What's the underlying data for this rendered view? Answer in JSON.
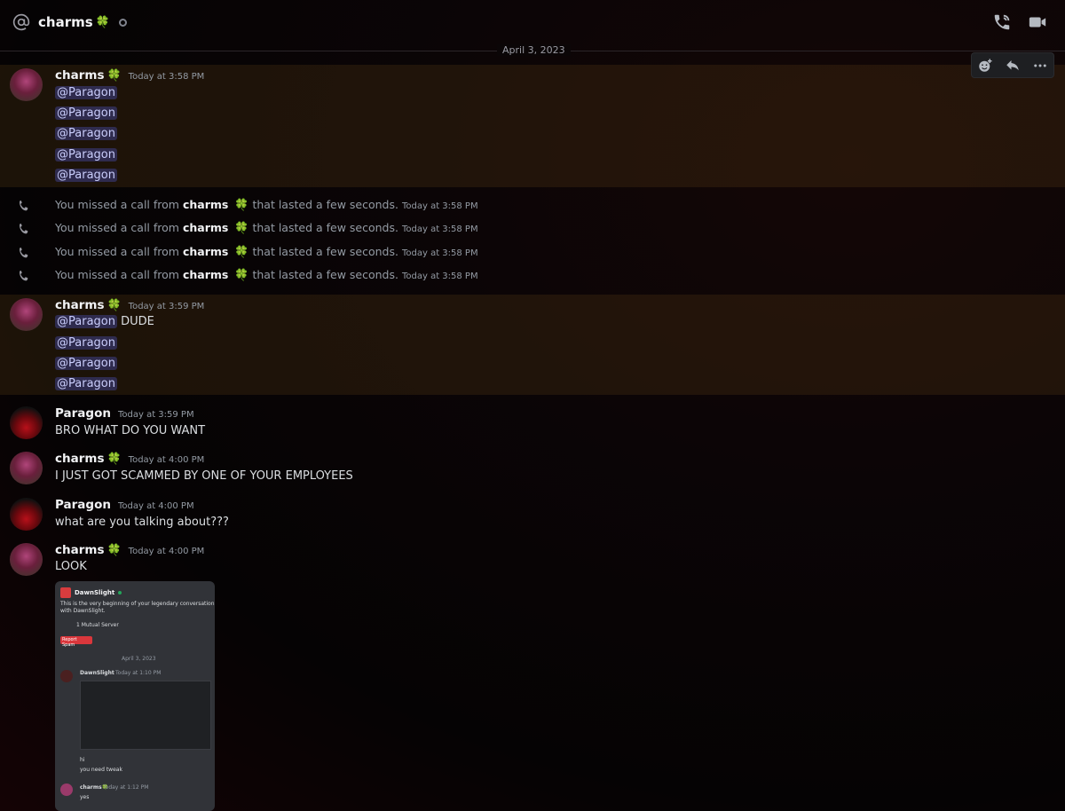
{
  "header": {
    "title": "charms",
    "title_emoji": "🍀"
  },
  "divider": {
    "date": "April 3, 2023"
  },
  "groups": [
    {
      "author": "charms",
      "emoji": "🍀",
      "timestamp": "Today at 3:58 PM",
      "lines": [
        "@Paragon",
        "@Paragon",
        "@Paragon",
        "@Paragon",
        "@Paragon"
      ]
    },
    {
      "author": "charms",
      "emoji": "🍀",
      "timestamp": "Today at 3:59 PM",
      "first_line_mention": "@Paragon",
      "first_line_text": " DUDE",
      "lines": [
        "@Paragon",
        "@Paragon",
        "@Paragon"
      ]
    },
    {
      "author": "Paragon",
      "timestamp": "Today at 3:59 PM",
      "text": "BRO WHAT DO YOU WANT"
    },
    {
      "author": "charms",
      "emoji": "🍀",
      "timestamp": "Today at 4:00 PM",
      "text": "I JUST GOT SCAMMED BY ONE OF YOUR EMPLOYEES"
    },
    {
      "author": "Paragon",
      "timestamp": "Today at 4:00 PM",
      "text": "what are you talking about???"
    },
    {
      "author": "charms",
      "emoji": "🍀",
      "timestamp": "Today at 4:00 PM",
      "text": "LOOK"
    }
  ],
  "missed_calls": [
    {
      "prefix": "You missed a call from ",
      "caller": "charms",
      "emoji": "🍀",
      "suffix": " that lasted a few seconds.",
      "timestamp": "Today at 3:58 PM"
    },
    {
      "prefix": "You missed a call from ",
      "caller": "charms",
      "emoji": "🍀",
      "suffix": " that lasted a few seconds.",
      "timestamp": "Today at 3:58 PM"
    },
    {
      "prefix": "You missed a call from ",
      "caller": "charms",
      "emoji": "🍀",
      "suffix": " that lasted a few seconds.",
      "timestamp": "Today at 3:58 PM"
    },
    {
      "prefix": "You missed a call from ",
      "caller": "charms",
      "emoji": "🍀",
      "suffix": " that lasted a few seconds.",
      "timestamp": "Today at 3:58 PM"
    }
  ],
  "attachment": {
    "header_name": "DawnSlight",
    "intro_text": "This is the very beginning of your legendary conversation",
    "intro_text2": "with DawnSlight.",
    "mutual": "1 Mutual Server",
    "report_button": "Report Spam",
    "date": "April 3, 2023",
    "msg1_author": "DawnSlight",
    "msg1_ts": "Today at 1:10 PM",
    "msg1_line1": "hi",
    "msg1_line2": "you need tweak",
    "msg2_author": "charms🍀",
    "msg2_ts": "Today at 1:12 PM",
    "msg2_line1": "yes"
  },
  "colors": {
    "mention_bg": "#5865f24d",
    "highlight": "#5a3c1447",
    "green": "#3ba55c"
  },
  "icons": [
    "at-icon",
    "phone-call-icon",
    "video-icon",
    "add-reaction-icon",
    "reply-icon",
    "more-icon",
    "missed-call-icon"
  ]
}
